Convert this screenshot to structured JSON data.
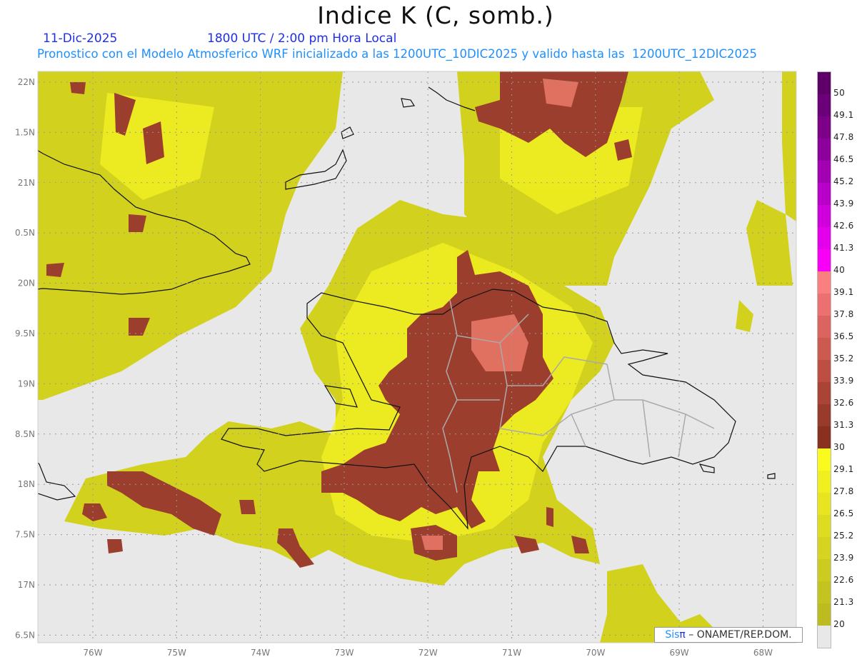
{
  "header": {
    "title": "Indice K (C, somb.)",
    "date": "11-Dic-2025",
    "time": "1800 UTC / 2:00 pm Hora Local",
    "description": "Pronostico con el Modelo Atmosferico WRF inicializado a las 1200UTC_10DIC2025 y valido hasta las  1200UTC_12DIC2025"
  },
  "map": {
    "lat_labels": [
      "22N",
      "1.5N",
      "21N",
      "0.5N",
      "20N",
      "9.5N",
      "19N",
      "8.5N",
      "18N",
      "7.5N",
      "17N",
      "6.5N"
    ],
    "lon_labels": [
      "76W",
      "75W",
      "74W",
      "73W",
      "72W",
      "71W",
      "70W",
      "69W",
      "68W"
    ],
    "background_color": "#e8e8e8"
  },
  "colorbar": {
    "labels": [
      "50",
      "49.1",
      "47.8",
      "46.5",
      "45.2",
      "43.9",
      "42.6",
      "41.3",
      "40",
      "39.1",
      "37.8",
      "36.5",
      "35.2",
      "33.9",
      "32.6",
      "31.3",
      "30",
      "29.1",
      "27.8",
      "26.5",
      "25.2",
      "23.9",
      "22.6",
      "21.3",
      "20"
    ],
    "colors": [
      "#5e0068",
      "#6c0078",
      "#7d0088",
      "#8e009c",
      "#a300b4",
      "#b800c8",
      "#d000dc",
      "#e400ec",
      "#f800f8",
      "#fa8080",
      "#ec7070",
      "#dc6460",
      "#cc5a50",
      "#bc4e42",
      "#aa4436",
      "#983a2c",
      "#8a3020",
      "#fafa1e",
      "#f0f020",
      "#e8e420",
      "#dedc20",
      "#d6d420",
      "#cccc20",
      "#c4c420",
      "#bcbc20",
      "#e8e8e8"
    ]
  },
  "credit": {
    "sis": "Sis",
    "pi": "π",
    "text": " –  ONAMET/REP.DOM."
  }
}
